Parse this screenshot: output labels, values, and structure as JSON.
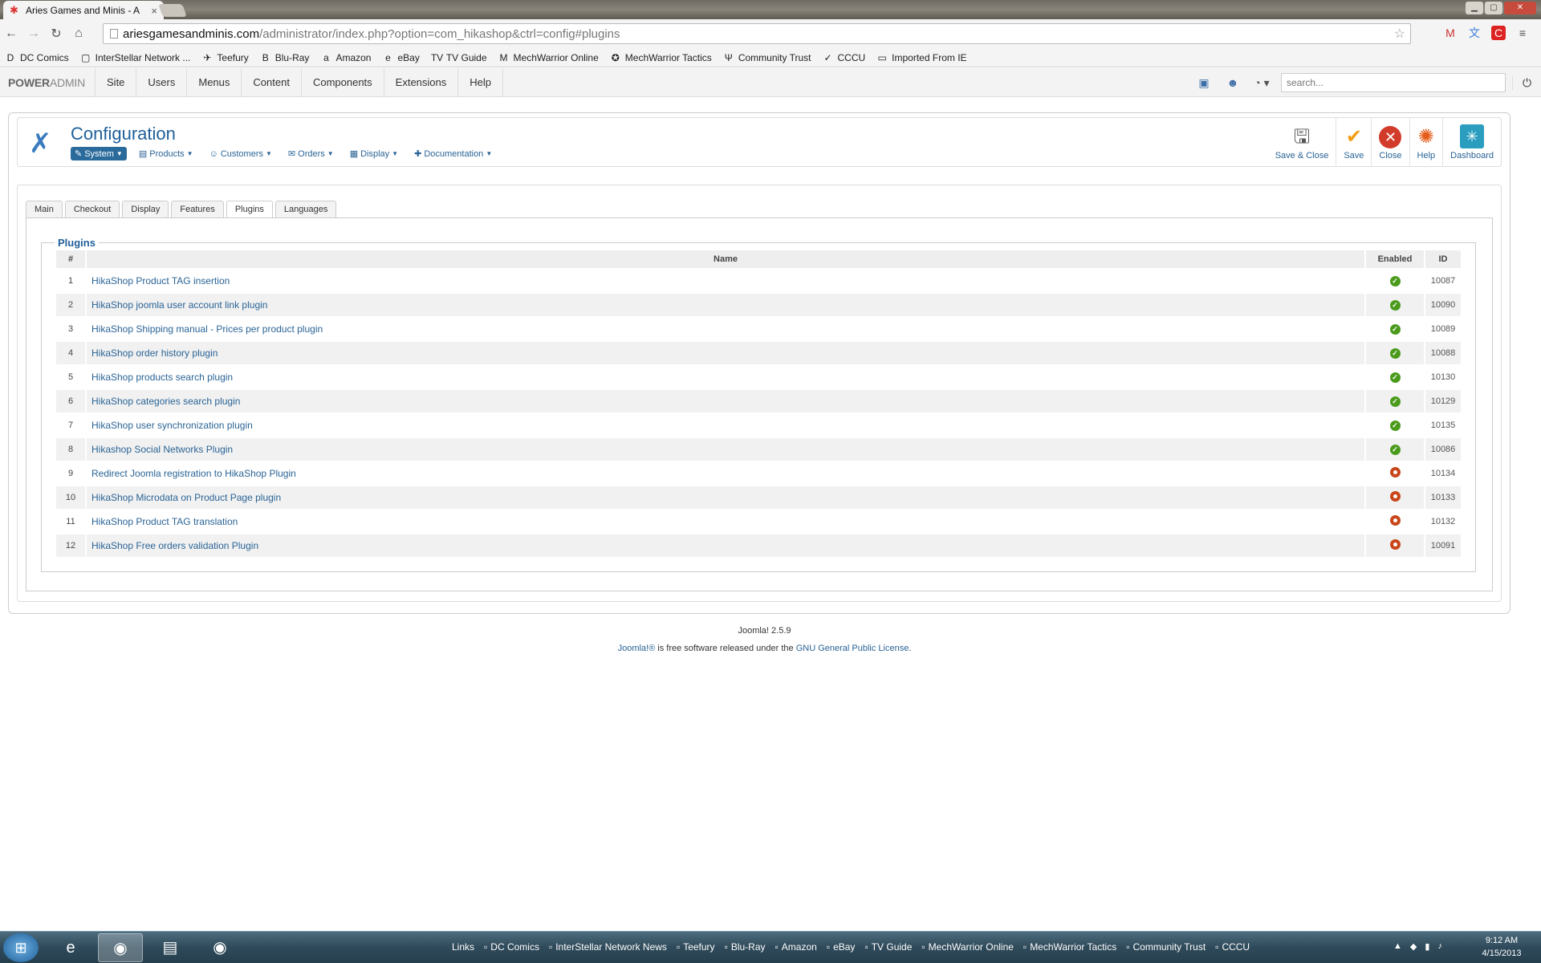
{
  "browser": {
    "tab_title": "Aries Games and Minis - A",
    "url_host": "ariesgamesandminis.com",
    "url_path": "/administrator/index.php?option=com_hikashop&ctrl=config#plugins",
    "bookmarks": [
      {
        "label": "DC Comics",
        "icon": "D"
      },
      {
        "label": "InterStellar Network ...",
        "icon": "▢"
      },
      {
        "label": "Teefury",
        "icon": "✈"
      },
      {
        "label": "Blu-Ray",
        "icon": "B"
      },
      {
        "label": "Amazon",
        "icon": "a"
      },
      {
        "label": "eBay",
        "icon": "e"
      },
      {
        "label": "TV Guide",
        "icon": "TV"
      },
      {
        "label": "MechWarrior Online",
        "icon": "M"
      },
      {
        "label": "MechWarrior Tactics",
        "icon": "✪"
      },
      {
        "label": "Community Trust",
        "icon": "Ψ"
      },
      {
        "label": "CCCU",
        "icon": "✓"
      },
      {
        "label": "Imported From IE",
        "icon": "▭"
      }
    ]
  },
  "admin": {
    "brand_bold": "POWER",
    "brand_light": "ADMIN",
    "menu": [
      "Site",
      "Users",
      "Menus",
      "Content",
      "Components",
      "Extensions",
      "Help"
    ],
    "search_placeholder": "search..."
  },
  "header": {
    "title": "Configuration",
    "submenu": [
      {
        "label": "System",
        "active": true,
        "icon": "✎"
      },
      {
        "label": "Products",
        "active": false,
        "icon": "▤"
      },
      {
        "label": "Customers",
        "active": false,
        "icon": "☺"
      },
      {
        "label": "Orders",
        "active": false,
        "icon": "✉"
      },
      {
        "label": "Display",
        "active": false,
        "icon": "▦"
      },
      {
        "label": "Documentation",
        "active": false,
        "icon": "✚"
      }
    ],
    "actions": [
      {
        "label": "Save & Close",
        "icon": "save-close"
      },
      {
        "label": "Save",
        "icon": "save"
      },
      {
        "label": "Close",
        "icon": "close"
      },
      {
        "label": "Help",
        "icon": "help"
      },
      {
        "label": "Dashboard",
        "icon": "dash"
      }
    ]
  },
  "tabs": [
    "Main",
    "Checkout",
    "Display",
    "Features",
    "Plugins",
    "Languages"
  ],
  "active_tab": "Plugins",
  "plugins": {
    "legend": "Plugins",
    "headers": {
      "num": "#",
      "name": "Name",
      "enabled": "Enabled",
      "id": "ID"
    },
    "rows": [
      {
        "num": "1",
        "name": "HikaShop Product TAG insertion",
        "enabled": true,
        "id": "10087"
      },
      {
        "num": "2",
        "name": "HikaShop joomla user account link plugin",
        "enabled": true,
        "id": "10090"
      },
      {
        "num": "3",
        "name": "HikaShop Shipping manual - Prices per product plugin",
        "enabled": true,
        "id": "10089"
      },
      {
        "num": "4",
        "name": "HikaShop order history plugin",
        "enabled": true,
        "id": "10088"
      },
      {
        "num": "5",
        "name": "HikaShop products search plugin",
        "enabled": true,
        "id": "10130"
      },
      {
        "num": "6",
        "name": "HikaShop categories search plugin",
        "enabled": true,
        "id": "10129"
      },
      {
        "num": "7",
        "name": "HikaShop user synchronization plugin",
        "enabled": true,
        "id": "10135"
      },
      {
        "num": "8",
        "name": "Hikashop Social Networks Plugin",
        "enabled": true,
        "id": "10086"
      },
      {
        "num": "9",
        "name": "Redirect Joomla registration to HikaShop Plugin",
        "enabled": false,
        "id": "10134"
      },
      {
        "num": "10",
        "name": "HikaShop Microdata on Product Page plugin",
        "enabled": false,
        "id": "10133"
      },
      {
        "num": "11",
        "name": "HikaShop Product TAG translation",
        "enabled": false,
        "id": "10132"
      },
      {
        "num": "12",
        "name": "HikaShop Free orders validation Plugin",
        "enabled": false,
        "id": "10091"
      }
    ]
  },
  "footer": {
    "version": "Joomla! 2.5.9",
    "license_link1": "Joomla!®",
    "license_text": " is free software released under the ",
    "license_link2": "GNU General Public License",
    "license_end": "."
  },
  "taskbar": {
    "links_label": "Links",
    "links": [
      "DC Comics",
      "InterStellar Network News",
      "Teefury",
      "Blu-Ray",
      "Amazon",
      "eBay",
      "TV Guide",
      "MechWarrior Online",
      "MechWarrior Tactics",
      "Community Trust",
      "CCCU"
    ],
    "time": "9:12 AM",
    "date": "4/15/2013"
  },
  "colors": {
    "accent": "#1f5f9a",
    "enabled": "#4a9a1c",
    "disabled": "#c8461a"
  }
}
